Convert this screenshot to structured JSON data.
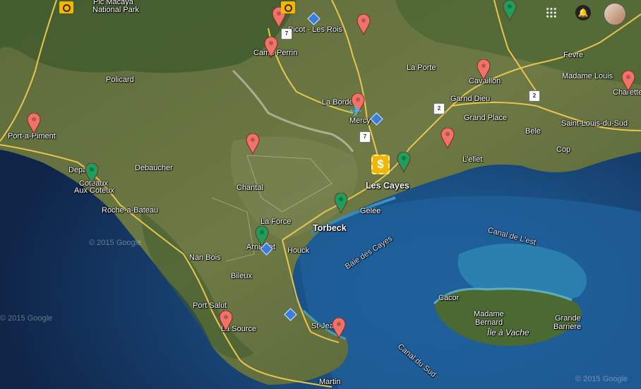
{
  "map": {
    "place_labels": [
      {
        "text": "Pic Macaya",
        "cls": ""
      },
      {
        "text": "National Park",
        "cls": ""
      },
      {
        "text": "Picot - Les Rois",
        "cls": ""
      },
      {
        "text": "Camp-Perrin",
        "cls": ""
      },
      {
        "text": "La Porte",
        "cls": ""
      },
      {
        "text": "Fevre",
        "cls": ""
      },
      {
        "text": "Madame Louis",
        "cls": ""
      },
      {
        "text": "Cavaillon",
        "cls": ""
      },
      {
        "text": "Charette",
        "cls": ""
      },
      {
        "text": "Policard",
        "cls": ""
      },
      {
        "text": "La Borde",
        "cls": ""
      },
      {
        "text": "Garnd Dieu",
        "cls": ""
      },
      {
        "text": "Mercy",
        "cls": ""
      },
      {
        "text": "Grand Place",
        "cls": ""
      },
      {
        "text": "Saint-Louis-du-Sud",
        "cls": ""
      },
      {
        "text": "Bele",
        "cls": ""
      },
      {
        "text": "Port-a-Piment",
        "cls": ""
      },
      {
        "text": "Cop",
        "cls": ""
      },
      {
        "text": "L'ellet",
        "cls": ""
      },
      {
        "text": "Debaucher",
        "cls": ""
      },
      {
        "text": "Depa",
        "cls": ""
      },
      {
        "text": "Coteaux",
        "cls": ""
      },
      {
        "text": "Aux Coteux",
        "cls": ""
      },
      {
        "text": "Chantal",
        "cls": ""
      },
      {
        "text": "Les Cayes",
        "cls": "big"
      },
      {
        "text": "Roche-a-Bateau",
        "cls": ""
      },
      {
        "text": "Gelée",
        "cls": ""
      },
      {
        "text": "La Force",
        "cls": ""
      },
      {
        "text": "Torbeck",
        "cls": "big"
      },
      {
        "text": "Arniquet",
        "cls": ""
      },
      {
        "text": "Houck",
        "cls": ""
      },
      {
        "text": "Canal de L'est",
        "cls": "water"
      },
      {
        "text": "Nan Bois",
        "cls": ""
      },
      {
        "text": "Baie des Cayes",
        "cls": "water"
      },
      {
        "text": "Bileux",
        "cls": ""
      },
      {
        "text": "Cacor",
        "cls": ""
      },
      {
        "text": "Port Salut",
        "cls": ""
      },
      {
        "text": "Madame",
        "cls": ""
      },
      {
        "text": "Bernard",
        "cls": ""
      },
      {
        "text": "Grande",
        "cls": ""
      },
      {
        "text": "Barriere",
        "cls": ""
      },
      {
        "text": "La Source",
        "cls": ""
      },
      {
        "text": "St-Jean",
        "cls": ""
      },
      {
        "text": "Île à Vache",
        "cls": "island"
      },
      {
        "text": "Canal du Sud",
        "cls": "water"
      },
      {
        "text": "Martin",
        "cls": ""
      }
    ],
    "route_shields": [
      "7",
      "2",
      "2",
      "7"
    ],
    "watermarks": [
      "© 2015 Google",
      "© 2015 Google",
      "© 2015 Google"
    ],
    "markers": {
      "red_pins": [
        "marker-red",
        "marker-red",
        "marker-red",
        "marker-red",
        "marker-red",
        "marker-red",
        "marker-red",
        "marker-red",
        "marker-red",
        "marker-red",
        "marker-red"
      ],
      "green_pins": [
        "marker-green",
        "marker-green",
        "marker-green",
        "marker-green",
        "marker-green"
      ],
      "blue_diamonds": [
        "diamond-marker",
        "diamond-marker",
        "diamond-marker",
        "diamond-marker"
      ],
      "camera_icons": [
        "camera-icon",
        "camera-icon"
      ],
      "airport_icon": "airplane-icon",
      "bank_icon": "dollar-icon",
      "bank_symbol": "$"
    },
    "colors": {
      "pin_red": "#f0736a",
      "pin_green": "#1e9e5a",
      "diamond_blue": "#3b7ddd",
      "road_yellow": "#e8c450",
      "sea_deep": "#14305a"
    }
  },
  "header": {
    "apps_icon": "apps-grid-icon",
    "notifications_icon": "bell-icon",
    "account_icon": "avatar"
  }
}
